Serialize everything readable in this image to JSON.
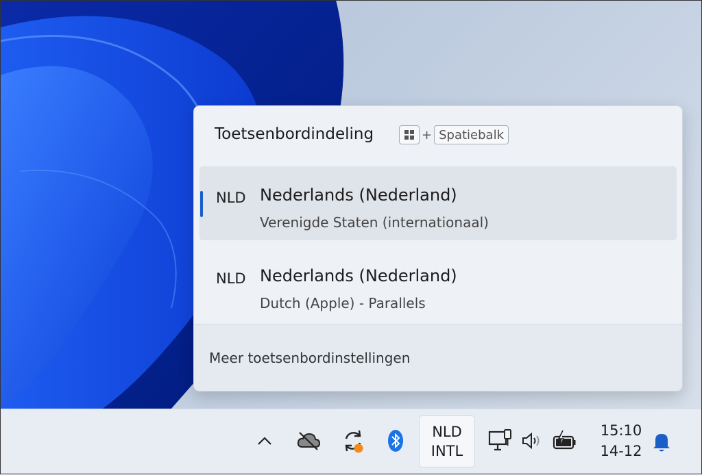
{
  "flyout": {
    "title": "Toetsenbordindeling",
    "shortcut": {
      "plus": "+",
      "space_key": "Spatiebalk"
    },
    "layouts": [
      {
        "code": "NLD",
        "name": "Nederlands (Nederland)",
        "detail": "Verenigde Staten (internationaal)",
        "selected": true
      },
      {
        "code": "NLD",
        "name": "Nederlands (Nederland)",
        "detail": "Dutch (Apple) - Parallels",
        "selected": false
      }
    ],
    "more_settings": "Meer toetsenbordinstellingen"
  },
  "taskbar": {
    "language": {
      "line1": "NLD",
      "line2": "INTL"
    },
    "time": "15:10",
    "date": "14-12",
    "icons": [
      "chevron-up-icon",
      "cloud-off-icon",
      "sync-icon",
      "bluetooth-icon",
      "network-icon",
      "volume-icon",
      "battery-charging-icon",
      "bell-icon"
    ],
    "accent_color": "#1a5fc8",
    "sync_badge_color": "#f28b1d"
  }
}
